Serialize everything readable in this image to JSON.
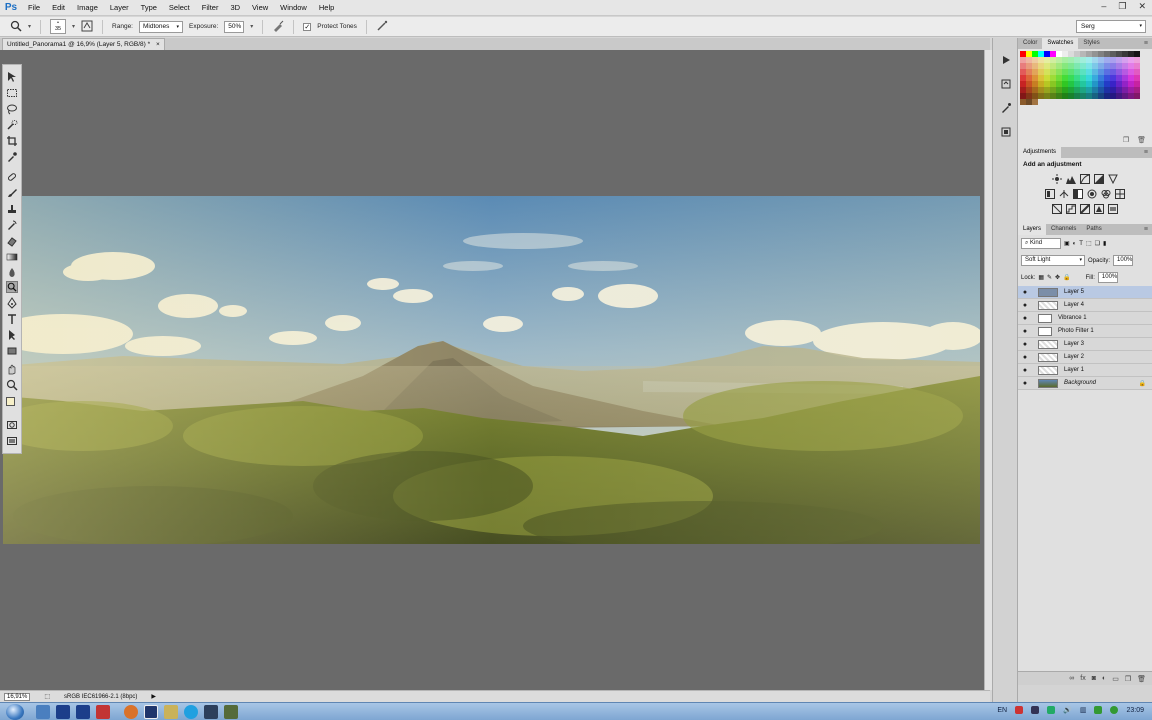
{
  "app": {
    "logo": "Ps"
  },
  "menu": [
    "File",
    "Edit",
    "Image",
    "Layer",
    "Type",
    "Select",
    "Filter",
    "3D",
    "View",
    "Window",
    "Help"
  ],
  "window_controls": {
    "minimize": "–",
    "restore": "❐",
    "close": "✕"
  },
  "options": {
    "brush_size": "35",
    "range_label": "Range:",
    "range_value": "Midtones",
    "exposure_label": "Exposure:",
    "exposure_value": "50%",
    "protect_tones_label": "Protect Tones",
    "protect_tones_checked": "✓",
    "workspace": "Serg"
  },
  "document": {
    "tab_title": "Untitled_Panorama1 @ 16,9% (Layer 5, RGB/8) *",
    "tab_close": "×"
  },
  "status": {
    "zoom": "16,91%",
    "profile": "sRGB IEC61966-2.1 (8bpc)"
  },
  "panels": {
    "top_tabs": [
      "Color",
      "Swatches",
      "Styles"
    ],
    "top_active": "Swatches",
    "adjustments_tab": "Adjustments",
    "adjustments_title": "Add an adjustment",
    "layers_tabs": [
      "Layers",
      "Channels",
      "Paths"
    ],
    "layers_active": "Layers",
    "kind_label": "Kind",
    "blend_mode": "Soft Light",
    "opacity_label": "Opacity:",
    "opacity_value": "100%",
    "lock_label": "Lock:",
    "fill_label": "Fill:",
    "fill_value": "100%",
    "menu_glyph": "≡"
  },
  "layers": [
    {
      "name": "Layer 5",
      "active": true
    },
    {
      "name": "Layer 4",
      "active": false
    },
    {
      "name": "Vibrance 1",
      "active": false
    },
    {
      "name": "Photo Filter 1",
      "active": false
    },
    {
      "name": "Layer 3",
      "active": false
    },
    {
      "name": "Layer 2",
      "active": false
    },
    {
      "name": "Layer 1",
      "active": false
    },
    {
      "name": "Background",
      "active": false
    }
  ],
  "taskbar": {
    "language": "EN",
    "clock": "23:09"
  },
  "colors": {
    "accent": "#1c6fc4",
    "active_layer": "#b9c9e3"
  }
}
